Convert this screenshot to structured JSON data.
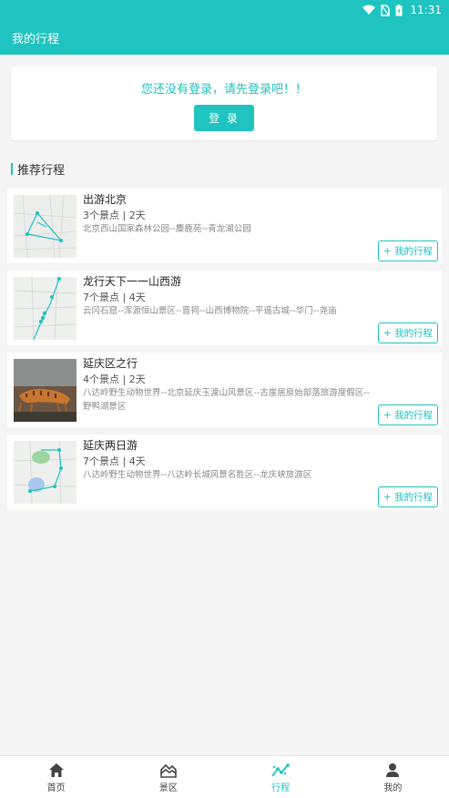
{
  "status": {
    "time": "11:31"
  },
  "appbar": {
    "title": "我的行程"
  },
  "login": {
    "message": "您还没有登录，请先登录吧！！",
    "button": "登 录"
  },
  "section": {
    "title": "推荐行程"
  },
  "trips": [
    {
      "name": "出游北京",
      "meta": "3个景点 | 2天",
      "spots": "北京西山国家森林公园--麋鹿苑--青龙湖公园",
      "add": "+ 我的行程"
    },
    {
      "name": "龙行天下一一山西游",
      "meta": "7个景点 | 4天",
      "spots": "云冈石窟--浑源恒山景区--晋祠--山西博物院--平遥古城--华门--尧庙",
      "add": "+ 我的行程"
    },
    {
      "name": "延庆区之行",
      "meta": "4个景点 | 2天",
      "spots": "八达岭野生动物世界--北京延庆玉渡山风景区--古崖居原始部落旅游度假区--野鸭湖景区",
      "add": "+ 我的行程"
    },
    {
      "name": "延庆两日游",
      "meta": "7个景点 | 4天",
      "spots": "八达岭野生动物世界--八达岭长城风景名胜区--龙庆峡旅游区",
      "add": "+ 我的行程"
    }
  ],
  "tabs": [
    {
      "label": "首页",
      "icon": "home-icon"
    },
    {
      "label": "景区",
      "icon": "mountain-icon"
    },
    {
      "label": "行程",
      "icon": "trend-icon",
      "active": true
    },
    {
      "label": "我的",
      "icon": "person-icon"
    }
  ],
  "colors": {
    "accent": "#1fc3bf"
  }
}
